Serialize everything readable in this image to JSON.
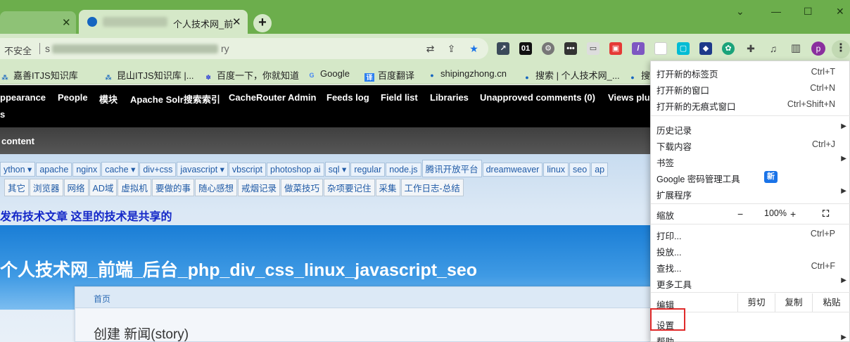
{
  "tabs": {
    "active_title": "个人技术网_前",
    "close": "✕",
    "new_tab": "+"
  },
  "window": {
    "minimize": "—",
    "maximize": "☐",
    "close": "✕"
  },
  "address": {
    "security_label": "不安全",
    "url_prefix": "s",
    "url_tail": "ry"
  },
  "profile_initial": "p",
  "bookmarks": [
    "嘉善ITJS知识库",
    "昆山ITJS知识库 |...",
    "百度一下，你就知道",
    "Google",
    "百度翻译",
    "shipingzhong.cn",
    "搜索 | 个人技术网_...",
    "搜"
  ],
  "admin_menu": [
    "ppearance",
    "People",
    "模块",
    "Apache Solr搜索索引",
    "CacheRouter Admin",
    "Feeds log",
    "Field list",
    "Libraries",
    "Unapproved comments (0)",
    "Views plu"
  ],
  "admin_second_line": "s",
  "content_bar_label": "content",
  "tags_row1": [
    "ython ▾",
    "apache",
    "nginx",
    "cache ▾",
    "div+css",
    "javascript ▾",
    "vbscript",
    "photoshop ai",
    "sql ▾",
    "regular",
    "node.js",
    "腾讯开放平台",
    "dreamweaver",
    "linux",
    "seo",
    "ap"
  ],
  "tags_row2": [
    "其它",
    "浏览器",
    "网络",
    "AD域",
    "虚拟机",
    "要做的事",
    "随心感想",
    "戒烟记录",
    "做菜技巧",
    "杂项要记住",
    "采集",
    "工作日志-总结"
  ],
  "slogan": "发布技术文章 这里的技术是共享的",
  "site_title": "个人技术网_前端_后台_php_div_css_linux_javascript_seo",
  "breadcrumb": "首页",
  "page_heading": "创建 新闻(story)",
  "menu": {
    "new_tab": {
      "label": "打开新的标签页",
      "shortcut": "Ctrl+T"
    },
    "new_window": {
      "label": "打开新的窗口",
      "shortcut": "Ctrl+N"
    },
    "incognito": {
      "label": "打开新的无痕式窗口",
      "shortcut": "Ctrl+Shift+N"
    },
    "history": {
      "label": "历史记录"
    },
    "downloads": {
      "label": "下载内容",
      "shortcut": "Ctrl+J"
    },
    "bookmarks": {
      "label": "书签"
    },
    "password_manager": {
      "label": "Google 密码管理工具",
      "badge": "新"
    },
    "extensions": {
      "label": "扩展程序"
    },
    "zoom": {
      "label": "缩放",
      "minus": "−",
      "value": "100%",
      "plus": "+"
    },
    "print": {
      "label": "打印...",
      "shortcut": "Ctrl+P"
    },
    "cast": {
      "label": "投放..."
    },
    "find": {
      "label": "查找...",
      "shortcut": "Ctrl+F"
    },
    "more_tools": {
      "label": "更多工具"
    },
    "edit": {
      "label": "编辑",
      "cut": "剪切",
      "copy": "复制",
      "paste": "粘贴"
    },
    "settings": {
      "label": "设置"
    },
    "help": {
      "label": "帮助"
    }
  },
  "colors": {
    "titlebar": "#6cae4c",
    "toolbar": "#d5e8c8",
    "highlight_box": "#e02a2a",
    "slogan": "#1428c8",
    "new_badge": "#1a73e8"
  }
}
